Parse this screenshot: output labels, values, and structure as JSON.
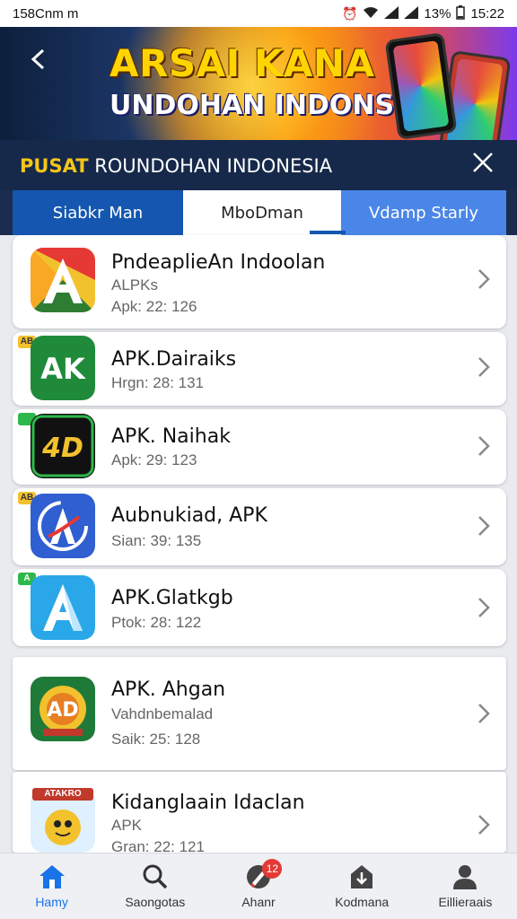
{
  "status_bar": {
    "left_text": "158Cnm m",
    "battery": "13%",
    "time": "15:22"
  },
  "banner": {
    "title_line1": "ARSAI KANA",
    "title_line2": "UNDOHAN INDONSIA"
  },
  "header": {
    "title_highlight": "PUSAT",
    "title_rest": " ROUNDOHAN INDONESIA"
  },
  "tabs": [
    {
      "label": "Siabkr Man",
      "state": "primary"
    },
    {
      "label": "MboDman",
      "state": "selected"
    },
    {
      "label": "Vdamp Starly",
      "state": "light"
    }
  ],
  "apps": [
    {
      "name": "PndeaplieAn Indoolan",
      "line1": "ALPKs",
      "line2": "Apk: 22: 126",
      "icon": "red-a-icon"
    },
    {
      "name": "APK.Dairaiks",
      "line1": "Hrgn: 28: 131",
      "icon": "green-ak-icon",
      "tag": "AB"
    },
    {
      "name": "APK. Naihak",
      "line1": "Apk: 29: 123",
      "icon": "black-4d-icon",
      "tag": ""
    },
    {
      "name": "Aubnukiad, APK",
      "line1": "Sian: 39: 135",
      "icon": "blue-swirl-a-icon",
      "tag": "AB"
    },
    {
      "name": "APK.Glatkgb",
      "line1": "Ptok: 28: 122",
      "icon": "blue-a-icon",
      "tag": "A"
    },
    {
      "name": "APK. Ahgan",
      "line1": "Vahdnbemalad",
      "line2": "Saik: 25: 128",
      "icon": "green-circle-icon"
    },
    {
      "name": "Kidanglaain Idaclan",
      "line1": "APK",
      "line2": "Gran: 22: 121",
      "icon": "cartoon-icon",
      "banner_text": "ATAKRO"
    }
  ],
  "bottom_nav": [
    {
      "label": "Hamy",
      "icon": "home-icon",
      "active": true
    },
    {
      "label": "Saongotas",
      "icon": "search-icon"
    },
    {
      "label": "Ahanr",
      "icon": "rocket-icon",
      "badge": "12"
    },
    {
      "label": "Kodmana",
      "icon": "download-box-icon"
    },
    {
      "label": "Eillieraais",
      "icon": "user-icon"
    }
  ],
  "colors": {
    "accent": "#1557b0",
    "header_bg": "#16294a",
    "highlight": "#f5c518"
  }
}
